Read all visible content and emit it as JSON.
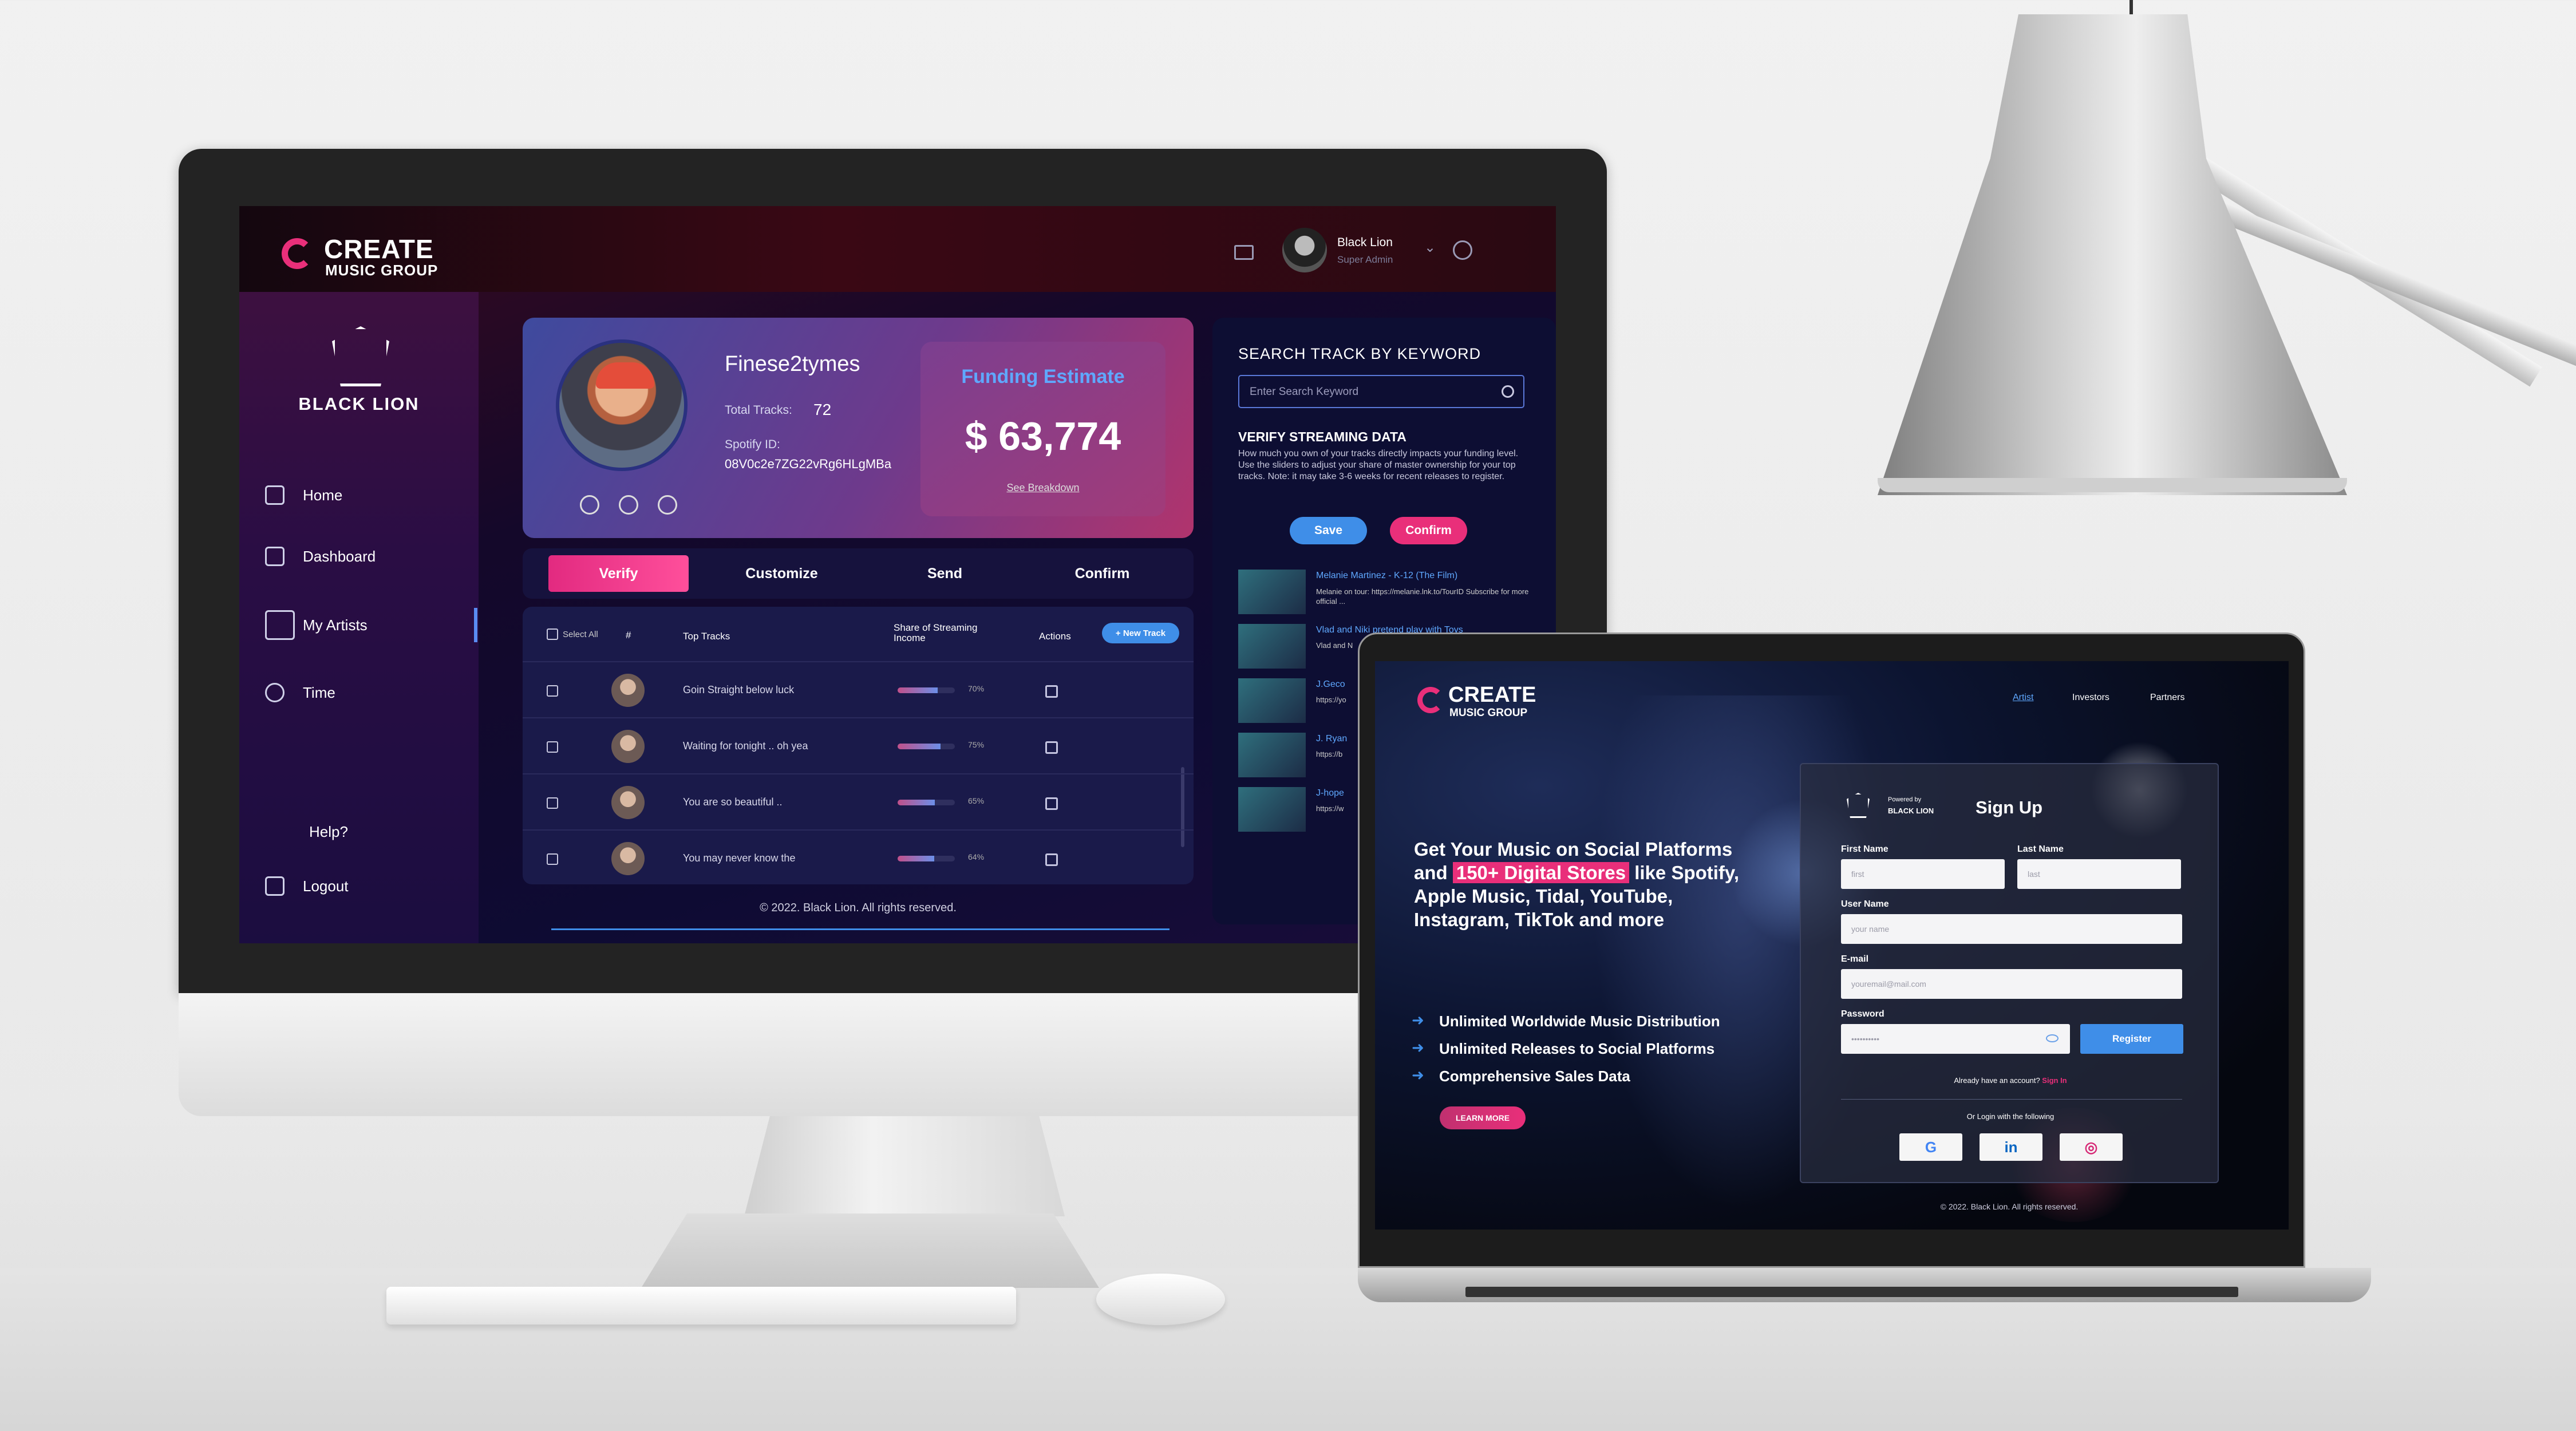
{
  "colors": {
    "accent_pink": "#e92f7a",
    "accent_blue": "#3f8ee8",
    "sidebar": "#2a0d44",
    "page_bg": "#0e0b33"
  },
  "desktop": {
    "logo": {
      "word": "CREATE",
      "sub": "MUSIC GROUP"
    },
    "user": {
      "name": "Black Lion",
      "role": "Super Admin"
    },
    "brand": "BLACK LION",
    "nav": [
      {
        "label": "Home",
        "icon": "home-icon"
      },
      {
        "label": "Dashboard",
        "icon": "grid-icon"
      },
      {
        "label": "My Artists",
        "icon": "guitar-icon"
      },
      {
        "label": "Time",
        "icon": "clock-icon"
      },
      {
        "label": "Help?",
        "icon": ""
      },
      {
        "label": "Logout",
        "icon": "logout-icon"
      }
    ],
    "artist": {
      "name": "Finese2tymes",
      "tracks_label": "Total Tracks:",
      "tracks": "72",
      "spotify_label": "Spotify ID:",
      "spotify_id": "08V0c2e7ZG22vRg6HLgMBa"
    },
    "funding": {
      "title": "Funding Estimate",
      "amount": "$ 63,774",
      "link": "See Breakdown"
    },
    "tabs": [
      "Verify",
      "Customize",
      "Send",
      "Confirm"
    ],
    "table": {
      "headers": [
        "Select All",
        "#",
        "Top Tracks",
        "Share of Streaming Income",
        "Actions"
      ],
      "new_track": "+ New Track",
      "rows": [
        {
          "title": "Goin Straight below luck",
          "share": "70%",
          "pct": 70
        },
        {
          "title": "Waiting for tonight .. oh yea",
          "share": "75%",
          "pct": 75
        },
        {
          "title": "You are so beautiful ..",
          "share": "65%",
          "pct": 65
        },
        {
          "title": "You may never know the",
          "share": "64%",
          "pct": 64
        }
      ]
    },
    "footer": "© 2022. Black Lion. All rights reserved.",
    "search": {
      "title": "SEARCH TRACK BY KEYWORD",
      "placeholder": "Enter Search Keyword"
    },
    "verify": {
      "title": "VERIFY STREAMING DATA",
      "text": "How much you own of your tracks directly impacts your funding level. Use the sliders to adjust your share of master ownership for your top tracks. Note: it may take 3-6 weeks for recent releases to register.",
      "save": "Save",
      "confirm": "Confirm"
    },
    "results": [
      {
        "title": "Melanie Martinez - K-12 (The Film)",
        "desc": "Melanie on tour: https://melanie.lnk.to/TourID Subscribe for more official ..."
      },
      {
        "title": "Vlad and Niki pretend play with Toys",
        "desc": "Vlad and N"
      },
      {
        "title": "J.Geco",
        "desc": "https://yo"
      },
      {
        "title": "J. Ryan",
        "desc": "https://b"
      },
      {
        "title": "J-hope",
        "desc": "https://w"
      }
    ]
  },
  "laptop": {
    "logo": {
      "word": "CREATE",
      "sub": "MUSIC GROUP"
    },
    "nav": [
      "Artist",
      "Investors",
      "Partners"
    ],
    "headline_pre": "Get Your Music on Social Platforms and",
    "headline_highlight": "150+ Digital Stores",
    "headline_post": "like Spotify, Apple Music, Tidal, YouTube, Instagram, TikTok and more",
    "features": [
      "Unlimited Worldwide Music Distribution",
      "Unlimited Releases to Social Platforms",
      "Comprehensive Sales Data"
    ],
    "cta": "LEARN MORE",
    "form": {
      "powered": "Powered by",
      "brand": "BLACK LION",
      "title": "Sign Up",
      "first_label": "First Name",
      "first_ph": "first",
      "last_label": "Last Name",
      "last_ph": "last",
      "user_label": "User Name",
      "user_ph": "your name",
      "email_label": "E-mail",
      "email_ph": "youremail@mail.com",
      "pass_label": "Password",
      "pass_ph": "••••••••••",
      "register": "Register",
      "have_account": "Already have an account?",
      "sign_in": "Sign In",
      "or": "Or Login with the following",
      "social": [
        "G",
        "in",
        "◎"
      ]
    },
    "footer": "© 2022. Black Lion. All rights reserved."
  }
}
